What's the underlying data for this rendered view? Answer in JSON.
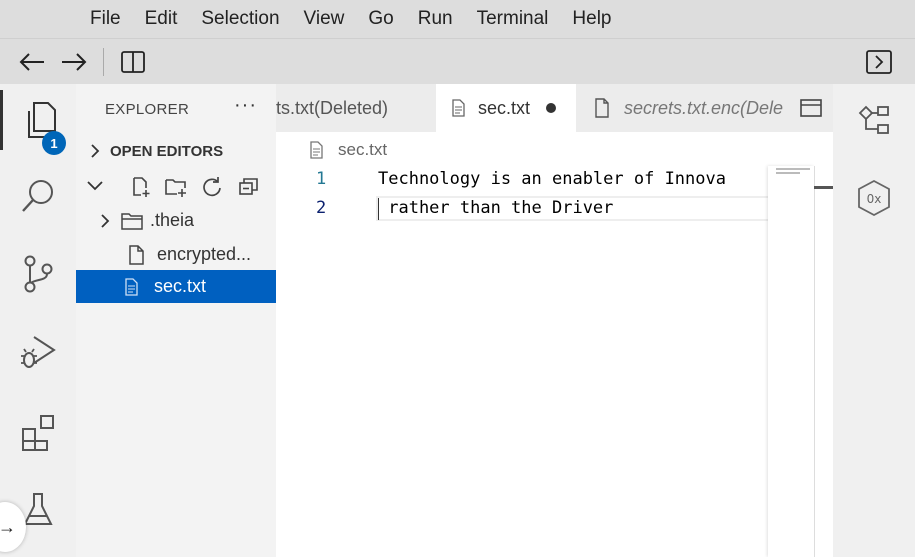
{
  "menu": [
    "File",
    "Edit",
    "Selection",
    "View",
    "Go",
    "Run",
    "Terminal",
    "Help"
  ],
  "toolbar": {
    "back_icon": "arrow-left-icon",
    "forward_icon": "arrow-right-icon",
    "layout_icon": "split-layout-icon",
    "panel_toggle_icon": "chevron-right-box-icon"
  },
  "activity_bar": {
    "items": [
      "explorer-icon",
      "search-icon",
      "source-control-icon",
      "run-debug-icon",
      "extensions-icon",
      "testing-icon"
    ],
    "explorer_badge": "1"
  },
  "sidebar": {
    "title": "EXPLORER",
    "more": "···",
    "open_editors_label": "OPEN EDITORS",
    "tree": [
      {
        "label": ".theia",
        "type": "folder"
      },
      {
        "label": "encrypted...",
        "type": "file"
      },
      {
        "label": "sec.txt",
        "type": "file",
        "selected": true
      }
    ]
  },
  "tabs": [
    {
      "label": "ts.txt(Deleted)"
    },
    {
      "label": "sec.txt",
      "active": true,
      "dirty": true
    },
    {
      "label": "secrets.txt.enc(Dele",
      "italic": true
    }
  ],
  "editor": {
    "breadcrumb": "sec.txt",
    "lines": [
      {
        "number": "1",
        "text": "Technology is an enabler of Innova"
      },
      {
        "number": "2",
        "text": " rather than the Driver"
      }
    ]
  },
  "right_bar": {
    "items": [
      "outline-icon",
      "memory-inspector-icon"
    ],
    "hex_label": "0x"
  },
  "colors": {
    "accent": "#0060c0",
    "badge": "#0066b8"
  }
}
